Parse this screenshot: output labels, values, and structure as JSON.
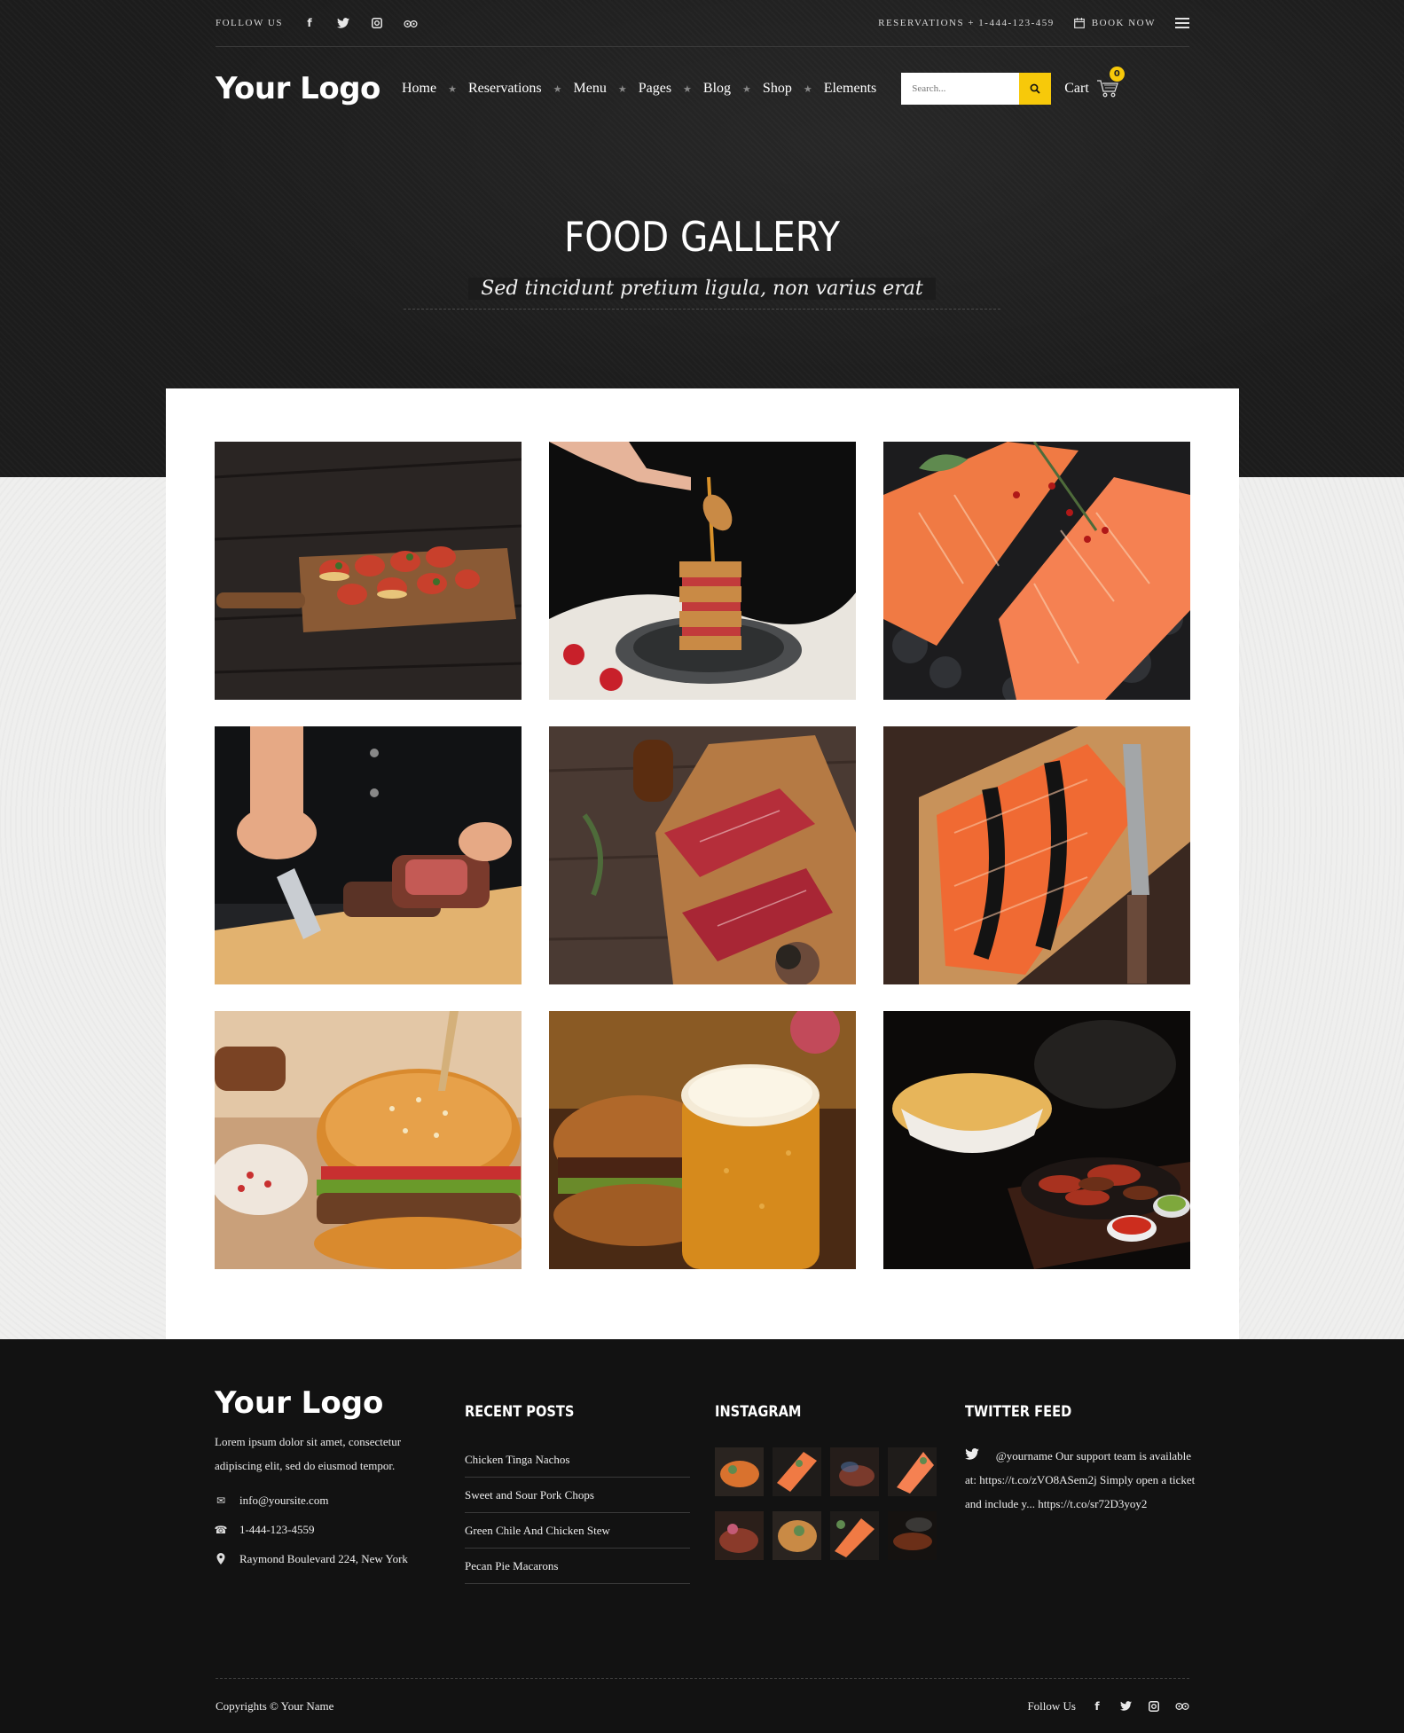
{
  "topbar": {
    "follow_label": "FOLLOW US",
    "social_icons": [
      "facebook-icon",
      "twitter-icon",
      "instagram-icon",
      "tripadvisor-icon"
    ],
    "reservations": "RESERVATIONS + 1-444-123-459",
    "book_now": "BOOK NOW"
  },
  "header": {
    "logo": "Your Logo",
    "nav": [
      "Home",
      "Reservations",
      "Menu",
      "Pages",
      "Blog",
      "Shop",
      "Elements"
    ],
    "search_placeholder": "Search...",
    "cart_label": "Cart",
    "cart_count": "0"
  },
  "hero": {
    "title": "FOOD GALLERY",
    "subtitle": "Sed tincidunt pretium ligula, non varius erat"
  },
  "gallery": {
    "items": [
      {
        "name": "bruschetta-board"
      },
      {
        "name": "honey-french-toast-stack"
      },
      {
        "name": "salmon-fillets"
      },
      {
        "name": "chef-slicing-steak"
      },
      {
        "name": "raw-beef-steaks"
      },
      {
        "name": "salmon-with-caviar"
      },
      {
        "name": "burger-with-rice"
      },
      {
        "name": "burger-and-beer"
      },
      {
        "name": "fajitas-and-quesadilla"
      }
    ]
  },
  "footer": {
    "logo": "Your Logo",
    "about": "Lorem ipsum dolor sit amet, consectetur adipiscing elit, sed do eiusmod tempor.",
    "email": "info@yoursite.com",
    "phone": "1-444-123-4559",
    "address": "Raymond Boulevard 224, New York",
    "recent_posts_heading": "RECENT POSTS",
    "recent_posts": [
      "Chicken Tinga Nachos",
      "Sweet and Sour Pork Chops",
      "Green Chile And Chicken Stew",
      "Pecan Pie Macarons"
    ],
    "instagram_heading": "INSTAGRAM",
    "twitter_heading": "TWITTER FEED",
    "tweet_handle": "@yourname",
    "tweet_text": "Our support team is available at: https://t.co/zVO8ASem2j Simply open a ticket and include y... https://t.co/sr72D3yoy2",
    "copyright": "Copyrights © Your Name",
    "follow_label": "Follow Us"
  }
}
